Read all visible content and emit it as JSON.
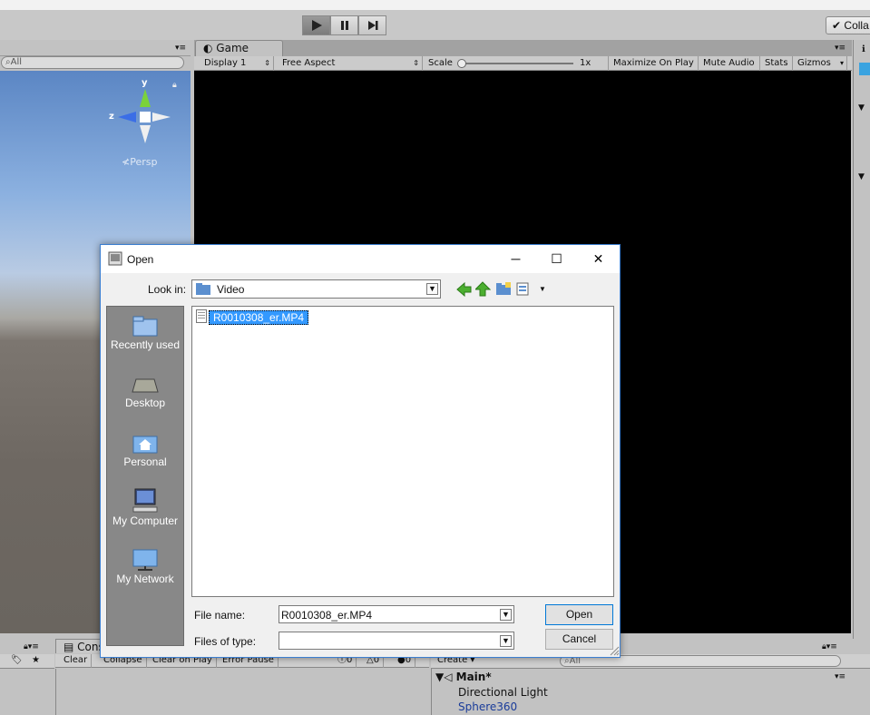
{
  "toolbar": {
    "collab_label": "Colla"
  },
  "scene": {
    "search_placeholder": "All",
    "projection_label": "Persp",
    "axis_y": "y",
    "axis_z": "z"
  },
  "game": {
    "tab_label": "Game",
    "display": "Display 1",
    "aspect": "Free Aspect",
    "scale_label": "Scale",
    "scale_value": "1x",
    "maximize_on_play": "Maximize On Play",
    "mute_audio": "Mute Audio",
    "stats": "Stats",
    "gizmos": "Gizmos"
  },
  "console": {
    "tab_label": "Cons",
    "buttons": [
      "Clear",
      "Collapse",
      "Clear on Play",
      "Error Pause"
    ],
    "counts": [
      "0",
      "0",
      "0"
    ]
  },
  "hierarchy": {
    "create_label": "Create",
    "search_placeholder": "All",
    "scene_name": "Main*",
    "items": [
      "Directional Light",
      "Sphere360"
    ]
  },
  "dialog": {
    "title": "Open",
    "look_in_label": "Look in:",
    "look_in_value": "Video",
    "places": [
      "Recently used",
      "Desktop",
      "Personal",
      "My Computer",
      "My Network"
    ],
    "files": [
      "R0010308_er.MP4"
    ],
    "file_name_label": "File name:",
    "file_name_value": "R0010308_er.MP4",
    "files_of_type_label": "Files of type:",
    "files_of_type_value": "",
    "open_button": "Open",
    "cancel_button": "Cancel"
  }
}
